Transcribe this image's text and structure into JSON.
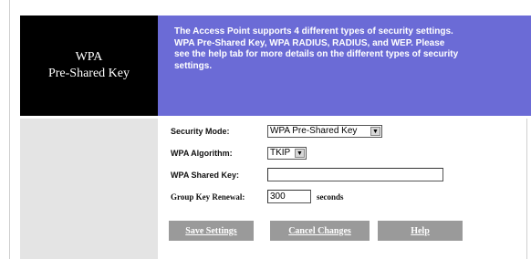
{
  "section": {
    "title_line1": "WPA",
    "title_line2": "Pre-Shared Key"
  },
  "banner": {
    "line1": "The Access Point supports 4 different types of security settings.",
    "line2": "WPA Pre-Shared Key, WPA RADIUS, RADIUS, and WEP. Please",
    "line3": "see the help tab for more details on the different types of security",
    "line4": "settings."
  },
  "form": {
    "security_mode": {
      "label": "Security Mode:",
      "value": "WPA Pre-Shared Key"
    },
    "wpa_algorithm": {
      "label": "WPA Algorithm:",
      "value": "TKIP"
    },
    "wpa_shared_key": {
      "label": "WPA Shared Key:",
      "value": ""
    },
    "group_key_renewal": {
      "label": "Group Key Renewal:",
      "value": "300",
      "suffix": "seconds"
    }
  },
  "buttons": {
    "save": "Save Settings",
    "cancel": "Cancel Changes",
    "help": "Help"
  },
  "colors": {
    "banner_bg": "#6b6bd6",
    "header_bg": "#000000",
    "left_col_bg": "#e4e4e4",
    "button_bg": "#9a9a9a"
  },
  "icons": {
    "dropdown": "chevron-down-icon"
  }
}
